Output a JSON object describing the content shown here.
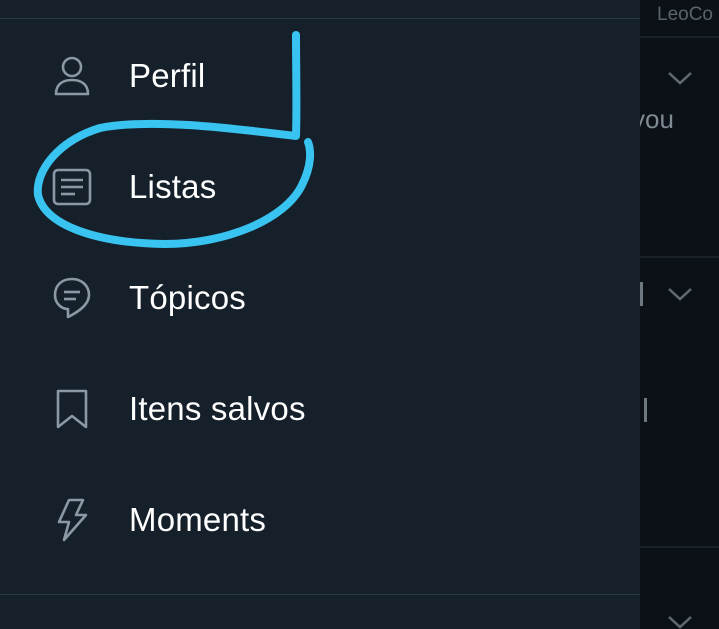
{
  "timeline": {
    "handle": "LeoCo",
    "snippet_1": "you"
  },
  "menu": {
    "items": [
      {
        "id": "perfil",
        "label": "Perfil",
        "icon": "person-icon"
      },
      {
        "id": "listas",
        "label": "Listas",
        "icon": "list-document-icon"
      },
      {
        "id": "topicos",
        "label": "Tópicos",
        "icon": "topics-speech-bubble-icon"
      },
      {
        "id": "itens-salvos",
        "label": "Itens salvos",
        "icon": "bookmark-icon"
      },
      {
        "id": "moments",
        "label": "Moments",
        "icon": "lightning-icon"
      }
    ]
  },
  "colors": {
    "drawer_bg": "#15202b",
    "text": "#ffffff",
    "icon": "#8b98a5",
    "annotation": "#38c3f0"
  }
}
